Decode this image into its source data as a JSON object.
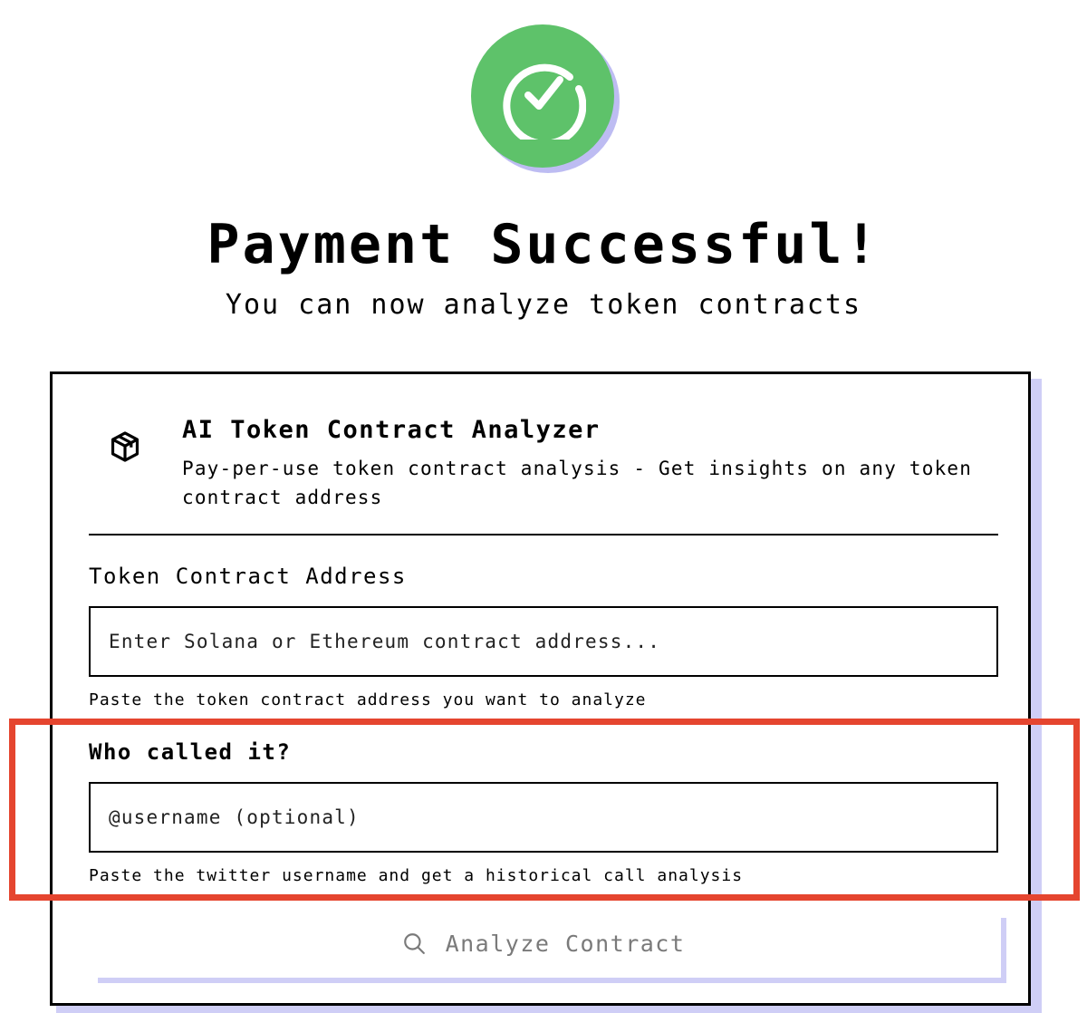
{
  "header": {
    "title": "Payment Successful!",
    "subtitle": "You can now analyze token contracts",
    "status_icon": "check-circle-icon"
  },
  "colors": {
    "success": "#5ec26a",
    "shadow": "#bdbcf2",
    "highlight": "#e5452f"
  },
  "card": {
    "icon": "cube-icon",
    "title": "AI Token Contract Analyzer",
    "description": "Pay-per-use token contract analysis - Get insights on any token contract address",
    "contract_field": {
      "label": "Token Contract Address",
      "value": "",
      "placeholder": "Enter Solana or Ethereum contract address...",
      "hint": "Paste the token contract address you want to analyze"
    },
    "caller_field": {
      "label": "Who called it?",
      "value": "",
      "placeholder": "@username (optional)",
      "hint": "Paste the twitter username and get a historical call analysis"
    },
    "analyze_button": {
      "label": "Analyze Contract",
      "icon": "search-icon"
    }
  }
}
